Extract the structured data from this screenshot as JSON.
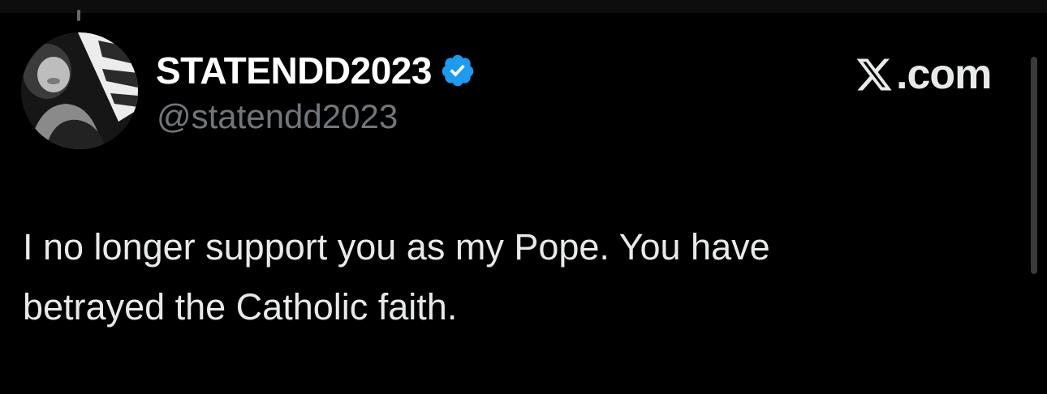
{
  "tweet": {
    "author": {
      "display_name": "STATENDD2023",
      "handle": "@statendd2023",
      "verified": true,
      "avatar_icon": "profile-photo"
    },
    "text_lines": [
      "I no longer support you as my Pope.  You have",
      "betrayed the Catholic faith."
    ]
  },
  "brand": {
    "icon": "x-logo-icon",
    "text": ".com"
  },
  "colors": {
    "background": "#000000",
    "name": "#ffffff",
    "body_text": "#e7e9ea",
    "handle": "#71767b",
    "verified_badge": "#1d9bf0"
  }
}
